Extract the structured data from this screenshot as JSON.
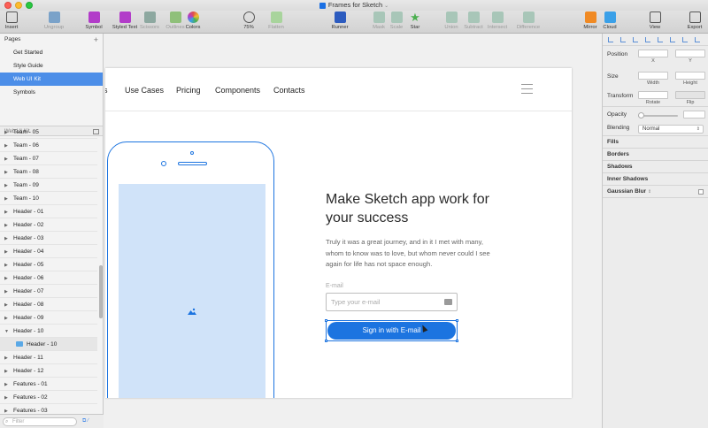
{
  "window": {
    "title": "Frames for Sketch"
  },
  "toolbar": {
    "items": [
      {
        "label": "Insert",
        "icon": "insert-icon",
        "color": "#555555"
      },
      {
        "label": "Ungroup",
        "icon": "ungroup-icon",
        "color": "#7aa2c9"
      },
      {
        "label": "Symbol",
        "icon": "symbol-icon",
        "color": "#b23cc9"
      },
      {
        "label": "Styled Text",
        "icon": "styled-text-icon",
        "color": "#b23cc9"
      },
      {
        "label": "Scissors",
        "icon": "scissors-icon",
        "color": "#8da8a0"
      },
      {
        "label": "Outlines",
        "icon": "outlines-icon",
        "color": "#8fc07a"
      },
      {
        "label": "Colors",
        "icon": "colors-icon",
        "color": "#e0504a"
      },
      {
        "label": "75%",
        "icon": "zoom-icon",
        "color": "#555555"
      },
      {
        "label": "Flatten",
        "icon": "flatten-icon",
        "color": "#a8d49c"
      },
      {
        "label": "Runner",
        "icon": "runner-icon",
        "color": "#2c5bbf"
      },
      {
        "label": "Mask",
        "icon": "mask-icon",
        "color": "#a8c6b8"
      },
      {
        "label": "Scale",
        "icon": "scale-icon",
        "color": "#a8c6b8"
      },
      {
        "label": "Star",
        "icon": "star-icon",
        "color": "#4caf50"
      },
      {
        "label": "Union",
        "icon": "union-icon",
        "color": "#a8c6b8"
      },
      {
        "label": "Subtract",
        "icon": "subtract-icon",
        "color": "#a8c6b8"
      },
      {
        "label": "Intersect",
        "icon": "intersect-icon",
        "color": "#a8c6b8"
      },
      {
        "label": "Difference",
        "icon": "difference-icon",
        "color": "#a8c6b8"
      },
      {
        "label": "Mirror",
        "icon": "mirror-icon",
        "color": "#f08a24"
      },
      {
        "label": "Cloud",
        "icon": "cloud-icon",
        "color": "#3aa0e8"
      },
      {
        "label": "View",
        "icon": "view-icon",
        "color": "#555555"
      },
      {
        "label": "Export",
        "icon": "export-icon",
        "color": "#555555"
      }
    ]
  },
  "sidebar": {
    "pages_header": "Pages",
    "pages": [
      {
        "label": "Get Started",
        "selected": false
      },
      {
        "label": "Style Guide",
        "selected": false
      },
      {
        "label": "Web UI Kit",
        "selected": true
      },
      {
        "label": "Symbols",
        "selected": false
      }
    ],
    "layers_header": "Web UI Kit",
    "layers": [
      {
        "label": "Team - 05",
        "expanded": false,
        "child": false
      },
      {
        "label": "Team - 06",
        "expanded": false,
        "child": false
      },
      {
        "label": "Team - 07",
        "expanded": false,
        "child": false
      },
      {
        "label": "Team - 08",
        "expanded": false,
        "child": false
      },
      {
        "label": "Team - 09",
        "expanded": false,
        "child": false
      },
      {
        "label": "Team - 10",
        "expanded": false,
        "child": false
      },
      {
        "label": "Header - 01",
        "expanded": false,
        "child": false
      },
      {
        "label": "Header - 02",
        "expanded": false,
        "child": false
      },
      {
        "label": "Header - 03",
        "expanded": false,
        "child": false
      },
      {
        "label": "Header - 04",
        "expanded": false,
        "child": false
      },
      {
        "label": "Header - 05",
        "expanded": false,
        "child": false
      },
      {
        "label": "Header - 06",
        "expanded": false,
        "child": false
      },
      {
        "label": "Header - 07",
        "expanded": false,
        "child": false
      },
      {
        "label": "Header - 08",
        "expanded": false,
        "child": false
      },
      {
        "label": "Header - 09",
        "expanded": false,
        "child": false
      },
      {
        "label": "Header - 10",
        "expanded": true,
        "child": false
      },
      {
        "label": "Header - 10",
        "expanded": false,
        "child": true
      },
      {
        "label": "Header - 11",
        "expanded": false,
        "child": false
      },
      {
        "label": "Header - 12",
        "expanded": false,
        "child": false
      },
      {
        "label": "Features - 01",
        "expanded": false,
        "child": false
      },
      {
        "label": "Features - 02",
        "expanded": false,
        "child": false
      },
      {
        "label": "Features - 03",
        "expanded": false,
        "child": false
      }
    ],
    "filter_placeholder": "Filter"
  },
  "canvas": {
    "nav_links": [
      "s",
      "Use Cases",
      "Pricing",
      "Components",
      "Contacts"
    ],
    "hero_title": "Make Sketch app work for your success",
    "hero_text": "Truly it was a great journey, and in it I met with many, whom to know was to love, but whom never could I see again for life has not space enough.",
    "email_label": "E-mail",
    "email_placeholder": "Type your e-mail",
    "signin_label": "Sign in with E-mail",
    "accent": "#1c74e0",
    "screen_color": "#d0e3f9"
  },
  "inspector": {
    "position_label": "Position",
    "x_label": "X",
    "y_label": "Y",
    "size_label": "Size",
    "width_label": "Width",
    "height_label": "Height",
    "transform_label": "Transform",
    "rotate_label": "Rotate",
    "flip_label": "Flip",
    "opacity_label": "Opacity",
    "blending_label": "Blending",
    "blending_value": "Normal",
    "sections": [
      "Fills",
      "Borders",
      "Shadows",
      "Inner Shadows",
      "Gaussian Blur"
    ]
  }
}
